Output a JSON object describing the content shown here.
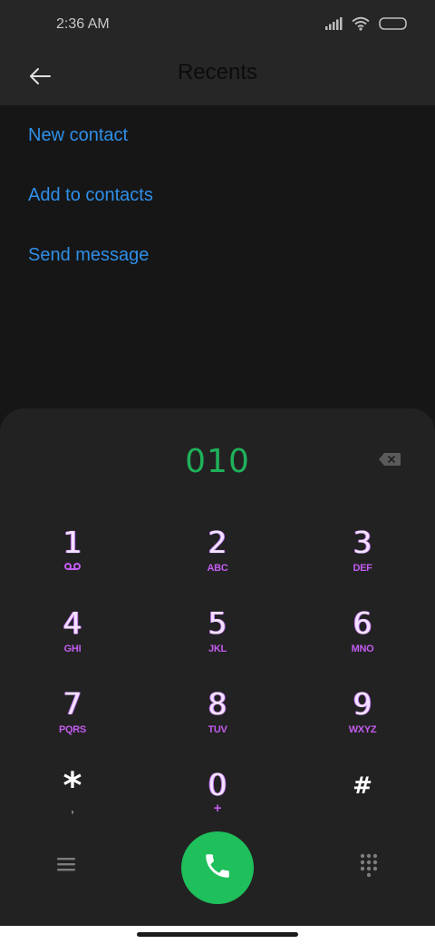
{
  "status_bar": {
    "time": "2:36 AM",
    "icons": [
      "signal-icon",
      "wifi-icon",
      "battery-icon"
    ]
  },
  "app_bar": {
    "title": "Recents",
    "back_icon": "arrow-left-icon"
  },
  "menu": {
    "items": [
      {
        "label": "New contact"
      },
      {
        "label": "Add to contacts"
      },
      {
        "label": "Send message"
      }
    ],
    "color": "#2f8fe8"
  },
  "dialer": {
    "number": "010",
    "number_color": "#1fb15a",
    "backspace_icon": "backspace-icon",
    "keys": [
      {
        "digit": "1",
        "letters": "",
        "icon": "voicemail-icon"
      },
      {
        "digit": "2",
        "letters": "ABC"
      },
      {
        "digit": "3",
        "letters": "DEF"
      },
      {
        "digit": "4",
        "letters": "GHI"
      },
      {
        "digit": "5",
        "letters": "JKL"
      },
      {
        "digit": "6",
        "letters": "MNO"
      },
      {
        "digit": "7",
        "letters": "PQRS"
      },
      {
        "digit": "8",
        "letters": "TUV"
      },
      {
        "digit": "9",
        "letters": "WXYZ"
      },
      {
        "digit": "*",
        "letters": ","
      },
      {
        "digit": "0",
        "letters": "+"
      },
      {
        "digit": "#",
        "letters": ""
      }
    ],
    "letters_color": "#c35cf0",
    "call_button_color": "#1fbf5b",
    "bottom_icons": [
      "menu-icon",
      "phone-icon",
      "keypad-icon"
    ]
  }
}
